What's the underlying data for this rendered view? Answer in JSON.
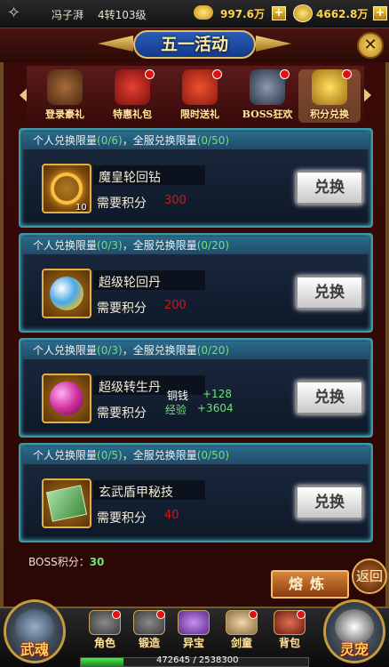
{
  "topbar": {
    "player_name": "冯子湃",
    "level": "4转103级",
    "ingot": "997.6万",
    "gold": "4662.8万"
  },
  "title": "五一活动",
  "tabs": [
    {
      "label": "登录豪礼",
      "selected": false
    },
    {
      "label": "特惠礼包",
      "selected": false
    },
    {
      "label": "限时送礼",
      "selected": false
    },
    {
      "label": "BOSS狂欢",
      "selected": false
    },
    {
      "label": "积分兑换",
      "selected": true
    }
  ],
  "items": [
    {
      "personal_label": "个人兑换限量",
      "personal": "(0/6)",
      "sep": "，",
      "server_label": "全服兑换限量",
      "server": "(0/50)",
      "name": "魔皇轮回钻",
      "cost_label": "需要积分",
      "cost": "300",
      "count": "10",
      "button": "兑换",
      "icon": "diamond-icon",
      "color": "#f0a020"
    },
    {
      "personal_label": "个人兑换限量",
      "personal": "(0/3)",
      "sep": "，",
      "server_label": "全服兑换限量",
      "server": "(0/20)",
      "name": "超级轮回丹",
      "cost_label": "需要积分",
      "cost": "200",
      "count": "",
      "button": "兑换",
      "icon": "pill-icon",
      "color": "#4aa8e8"
    },
    {
      "personal_label": "个人兑换限量",
      "personal": "(0/3)",
      "sep": "，",
      "server_label": "全服兑换限量",
      "server": "(0/20)",
      "name": "超级转生丹",
      "cost_label": "需要积分",
      "cost": "",
      "count": "",
      "button": "兑换",
      "icon": "orb-icon",
      "color": "#d030a0"
    },
    {
      "personal_label": "个人兑换限量",
      "personal": "(0/5)",
      "sep": "，",
      "server_label": "全服兑换限量",
      "server": "(0/50)",
      "name": "玄武盾甲秘技",
      "cost_label": "需要积分",
      "cost": "40",
      "count": "",
      "button": "兑换",
      "icon": "book-icon",
      "color": "#40a040"
    }
  ],
  "floating": {
    "copper_label": "铜钱",
    "copper": "+128",
    "exp_label": "经验",
    "exp": "+3604"
  },
  "boss_points": {
    "label": "BOSS积分：",
    "value": "30"
  },
  "smelt_button": "熔炼",
  "back_button": "返回",
  "bottom": {
    "left_big": "武魂",
    "right_big": "灵宠",
    "items": [
      "角色",
      "锻造",
      "异宝",
      "剑童",
      "背包"
    ],
    "xp_text": "472645 / 2538300",
    "xp_fraction": 0.186
  }
}
